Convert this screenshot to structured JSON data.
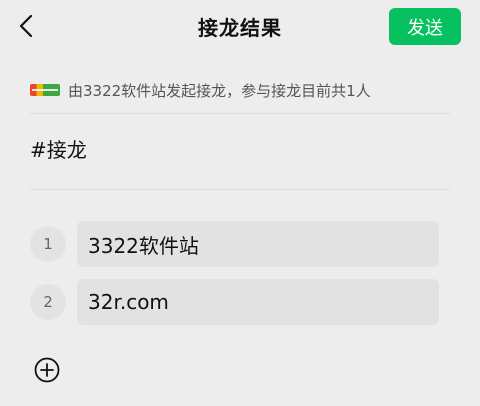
{
  "header": {
    "title": "接龙结果",
    "send_label": "发送"
  },
  "initiator": {
    "text": "由3322软件站发起接龙，参与接龙目前共1人"
  },
  "topic": {
    "hashtag": "#接龙"
  },
  "entries": [
    {
      "number": "1",
      "value": "3322软件站"
    },
    {
      "number": "2",
      "value": "32r.com"
    }
  ],
  "icons": {
    "back": "back-chevron-icon",
    "add": "plus-circle-icon",
    "logo": "site-logo-icon"
  },
  "colors": {
    "accent": "#07c160",
    "background": "#ededed",
    "field": "#e2e2e2"
  }
}
